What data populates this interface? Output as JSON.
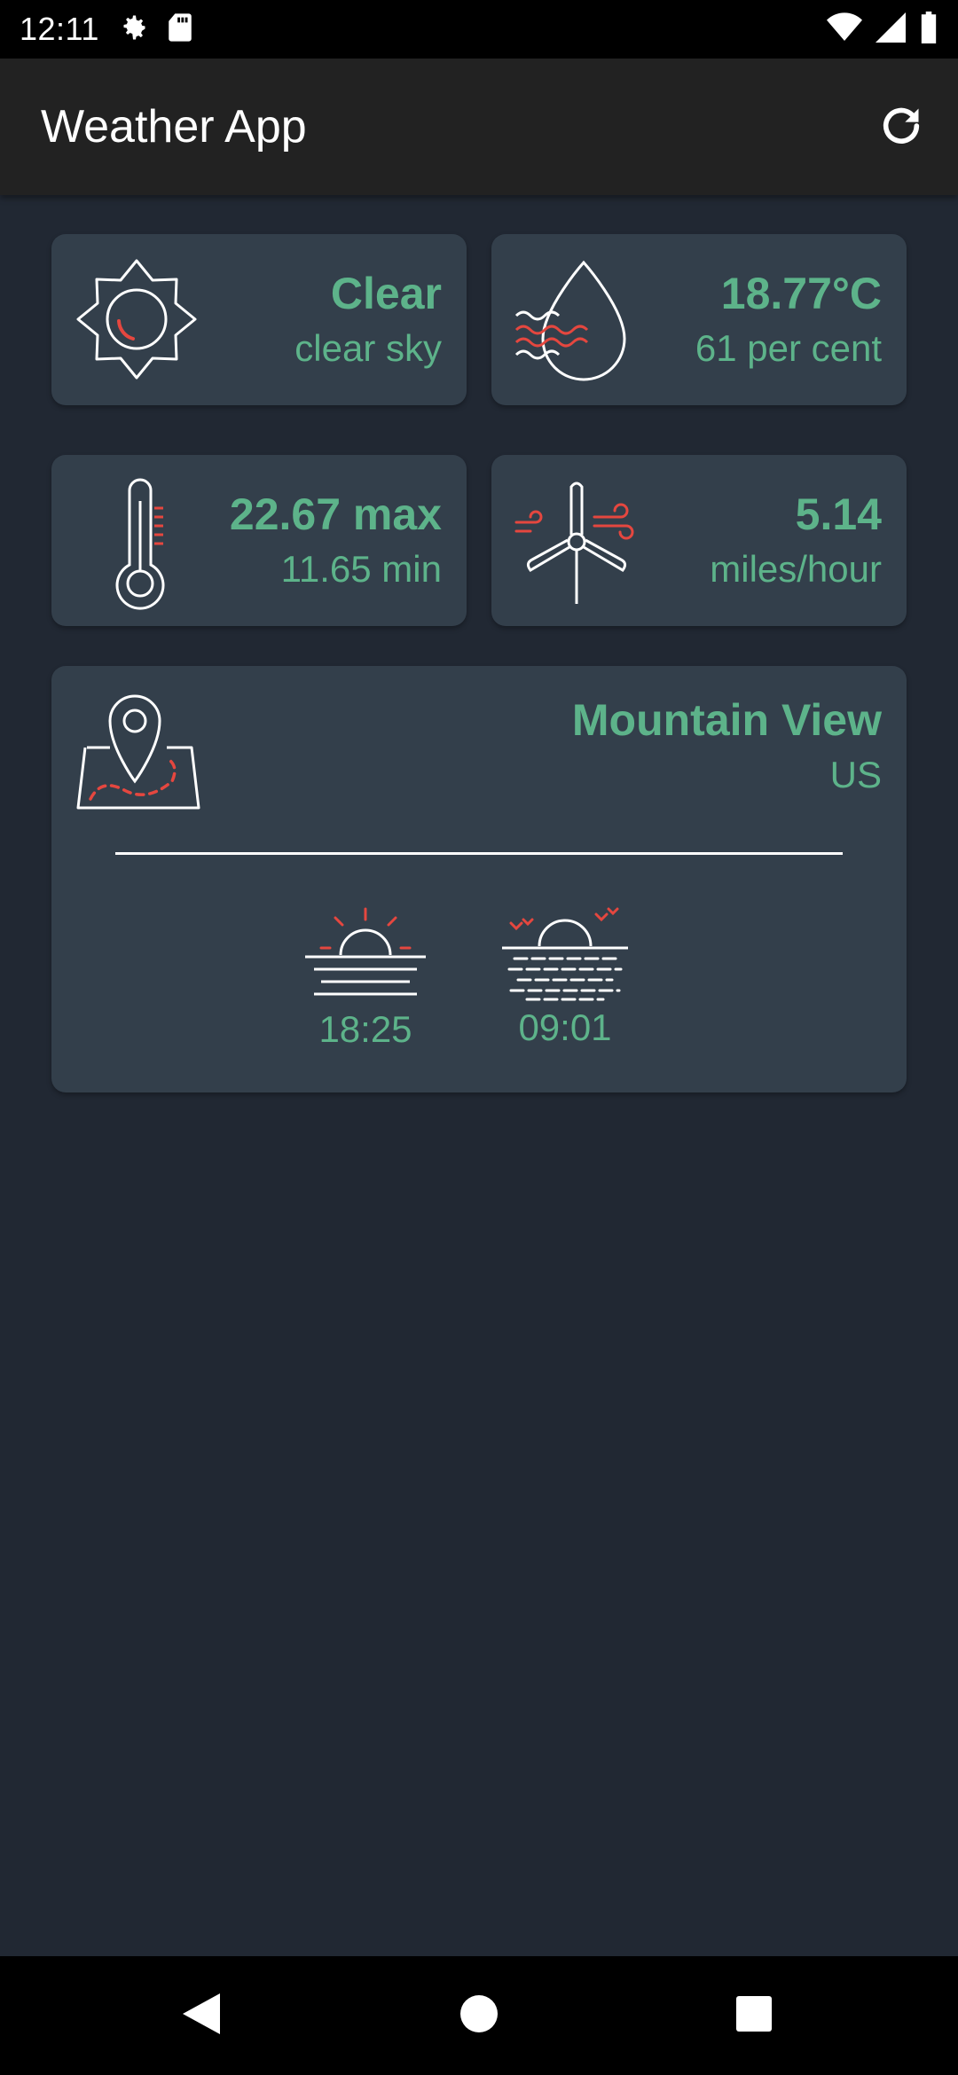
{
  "status_bar": {
    "time": "12:11",
    "icons": [
      "settings-icon",
      "sd-card-icon",
      "wifi-icon",
      "signal-icon",
      "battery-icon"
    ]
  },
  "app_bar": {
    "title": "Weather App",
    "refresh_icon": "refresh-icon"
  },
  "cards": {
    "condition": {
      "primary": "Clear",
      "secondary": "clear sky",
      "icon": "sun-icon"
    },
    "humidity": {
      "primary": "18.77°C",
      "secondary": "61 per cent",
      "icon": "water-drop-icon"
    },
    "temperature": {
      "primary": "22.67 max",
      "secondary": "11.65 min",
      "icon": "thermometer-icon"
    },
    "wind": {
      "primary": "5.14",
      "secondary": "miles/hour",
      "icon": "wind-turbine-icon"
    },
    "location": {
      "city": "Mountain View",
      "country": "US",
      "icon": "map-pin-icon",
      "sunset": {
        "time": "18:25",
        "icon": "sunset-icon"
      },
      "sunrise": {
        "time": "09:01",
        "icon": "sunrise-icon"
      }
    }
  },
  "colors": {
    "background": "#212833",
    "card": "#333f4b",
    "accent_green": "#5db38a",
    "accent_red": "#e5473f",
    "app_bar": "#222222"
  },
  "nav_bar": {
    "buttons": [
      "back-icon",
      "home-icon",
      "recents-icon"
    ]
  }
}
